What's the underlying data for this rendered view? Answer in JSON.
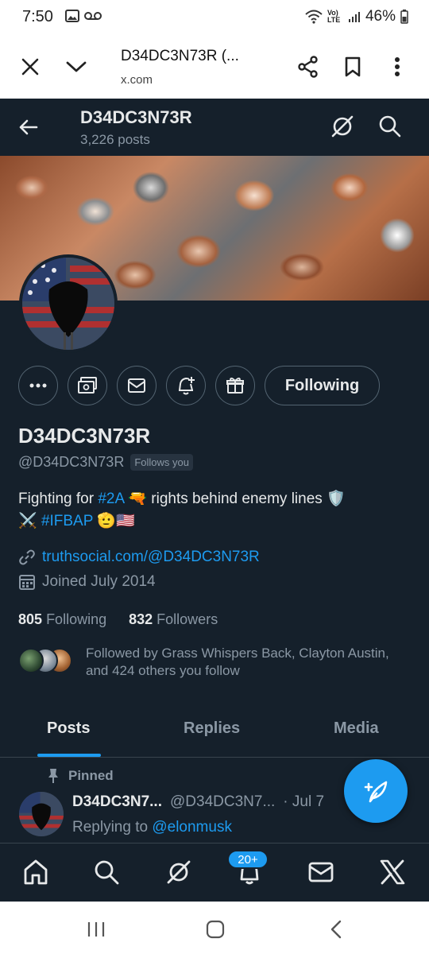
{
  "status_bar": {
    "time": "7:50",
    "battery": "46%",
    "network": "Vo) LTE"
  },
  "browser": {
    "title": "D34DC3N73R (...",
    "url": "x.com"
  },
  "profile_header": {
    "name": "D34DC3N73R",
    "post_count": "3,226 posts"
  },
  "actions": {
    "following_label": "Following"
  },
  "profile": {
    "display_name": "D34DC3N73R",
    "handle": "@D34DC3N73R",
    "follows_you": "Follows you",
    "bio": {
      "part1": "Fighting for ",
      "hashtag1": "#2A",
      "part2": " 🔫 rights behind enemy lines 🛡️",
      "part3": "⚔️ ",
      "hashtag2": "#IFBAP",
      "part4": " 🫡🇺🇸"
    },
    "link": "truthsocial.com/@D34DC3N73R",
    "joined": "Joined July 2014",
    "following_count": "805",
    "following_label": "Following",
    "followers_count": "832",
    "followers_label": "Followers",
    "followed_by": "Followed by Grass Whispers Back, Clayton Austin, and 424 others you follow"
  },
  "tabs": [
    {
      "label": "Posts",
      "active": true
    },
    {
      "label": "Replies",
      "active": false
    },
    {
      "label": "Media",
      "active": false
    }
  ],
  "post": {
    "pinned_label": "Pinned",
    "name": "D34DC3N7...",
    "handle": "@D34DC3N7...",
    "date": "· Jul 7",
    "replying_prefix": "Replying to ",
    "replying_to": "@elonmusk"
  },
  "bottom_nav": {
    "notifications_badge": "20+"
  },
  "colors": {
    "background": "#15202b",
    "accent": "#1d9bf0",
    "muted": "#8b98a5",
    "text": "#e7e9ea"
  }
}
